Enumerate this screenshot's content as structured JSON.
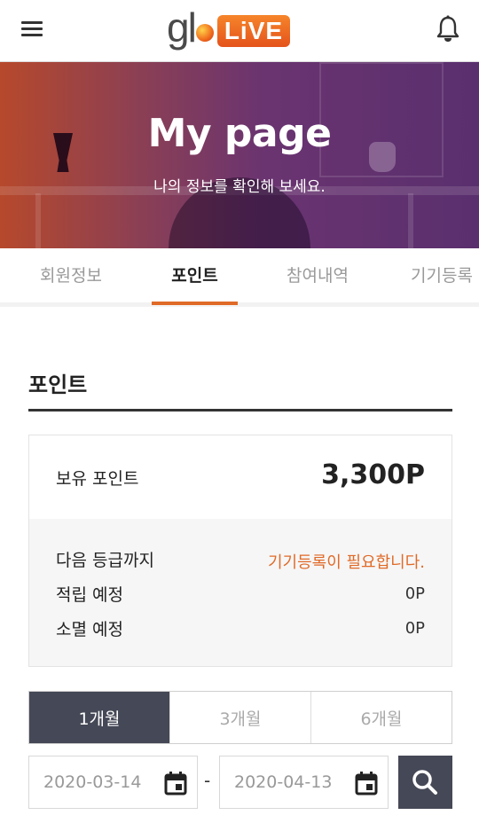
{
  "header": {
    "logo_primary": "glo",
    "logo_badge": "LiVE",
    "menu_icon": "menu-icon",
    "notification_icon": "bell-icon"
  },
  "hero": {
    "title": "My page",
    "subtitle": "나의 정보를 확인해 보세요."
  },
  "tabs": [
    {
      "label": "회원정보",
      "active": false
    },
    {
      "label": "포인트",
      "active": true
    },
    {
      "label": "참여내역",
      "active": false
    },
    {
      "label": "기기등록",
      "active": false
    }
  ],
  "section": {
    "title": "포인트"
  },
  "points": {
    "held_label": "보유 포인트",
    "held_value": "3,300P",
    "rows": [
      {
        "label": "다음 등급까지",
        "value": "기기등록이 필요합니다.",
        "alert": true
      },
      {
        "label": "적립 예정",
        "value": "0P",
        "alert": false
      },
      {
        "label": "소멸 예정",
        "value": "0P",
        "alert": false
      }
    ]
  },
  "period": {
    "options": [
      {
        "label": "1개월",
        "selected": true
      },
      {
        "label": "3개월",
        "selected": false
      },
      {
        "label": "6개월",
        "selected": false
      }
    ]
  },
  "date_range": {
    "start": "2020-03-14",
    "separator": "-",
    "end": "2020-04-13",
    "calendar_icon": "calendar-icon",
    "search_icon": "search-icon"
  },
  "colors": {
    "accent": "#e06a27",
    "dark_button": "#454856",
    "hero_start": "#b6492c",
    "hero_end": "#5a2f6e"
  }
}
